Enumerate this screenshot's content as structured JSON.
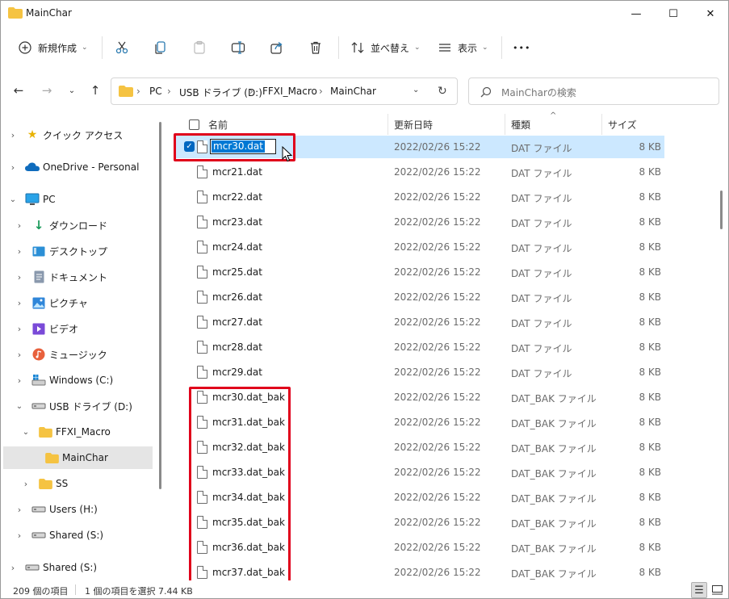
{
  "window": {
    "title": "MainChar",
    "minimize": "—",
    "maximize": "☐",
    "close": "✕"
  },
  "toolbar": {
    "new_label": "新規作成",
    "cut_icon": "scissors-icon",
    "copy_icon": "copy-icon",
    "paste_icon": "paste-icon",
    "rename_icon": "rename-icon",
    "share_icon": "share-icon",
    "delete_icon": "trash-icon",
    "sort_label": "並べ替え",
    "view_label": "表示",
    "more_label": "•••"
  },
  "address": {
    "crumbs": [
      "PC",
      "USB ドライブ (D:)",
      "FFXI_Macro",
      "MainChar"
    ],
    "search_placeholder": "MainCharの検索"
  },
  "nav": {
    "items": [
      {
        "label": "クイック アクセス"
      },
      {
        "label": "OneDrive - Personal"
      },
      {
        "label": "PC"
      },
      {
        "label": "ダウンロード"
      },
      {
        "label": "デスクトップ"
      },
      {
        "label": "ドキュメント"
      },
      {
        "label": "ピクチャ"
      },
      {
        "label": "ビデオ"
      },
      {
        "label": "ミュージック"
      },
      {
        "label": "Windows (C:)"
      },
      {
        "label": "USB ドライブ (D:)"
      },
      {
        "label": "FFXI_Macro"
      },
      {
        "label": "MainChar"
      },
      {
        "label": "SS"
      },
      {
        "label": "Users (H:)"
      },
      {
        "label": "Shared (S:)"
      },
      {
        "label": "Shared (S:)"
      }
    ]
  },
  "columns": {
    "name": "名前",
    "date": "更新日時",
    "type": "種類",
    "size": "サイズ"
  },
  "files": [
    {
      "name": "mcr30.dat",
      "date": "2022/02/26 15:22",
      "type": "DAT ファイル",
      "size": "8 KB"
    },
    {
      "name": "mcr21.dat",
      "date": "2022/02/26 15:22",
      "type": "DAT ファイル",
      "size": "8 KB"
    },
    {
      "name": "mcr22.dat",
      "date": "2022/02/26 15:22",
      "type": "DAT ファイル",
      "size": "8 KB"
    },
    {
      "name": "mcr23.dat",
      "date": "2022/02/26 15:22",
      "type": "DAT ファイル",
      "size": "8 KB"
    },
    {
      "name": "mcr24.dat",
      "date": "2022/02/26 15:22",
      "type": "DAT ファイル",
      "size": "8 KB"
    },
    {
      "name": "mcr25.dat",
      "date": "2022/02/26 15:22",
      "type": "DAT ファイル",
      "size": "8 KB"
    },
    {
      "name": "mcr26.dat",
      "date": "2022/02/26 15:22",
      "type": "DAT ファイル",
      "size": "8 KB"
    },
    {
      "name": "mcr27.dat",
      "date": "2022/02/26 15:22",
      "type": "DAT ファイル",
      "size": "8 KB"
    },
    {
      "name": "mcr28.dat",
      "date": "2022/02/26 15:22",
      "type": "DAT ファイル",
      "size": "8 KB"
    },
    {
      "name": "mcr29.dat",
      "date": "2022/02/26 15:22",
      "type": "DAT ファイル",
      "size": "8 KB"
    },
    {
      "name": "mcr30.dat_bak",
      "date": "2022/02/26 15:22",
      "type": "DAT_BAK ファイル",
      "size": "8 KB"
    },
    {
      "name": "mcr31.dat_bak",
      "date": "2022/02/26 15:22",
      "type": "DAT_BAK ファイル",
      "size": "8 KB"
    },
    {
      "name": "mcr32.dat_bak",
      "date": "2022/02/26 15:22",
      "type": "DAT_BAK ファイル",
      "size": "8 KB"
    },
    {
      "name": "mcr33.dat_bak",
      "date": "2022/02/26 15:22",
      "type": "DAT_BAK ファイル",
      "size": "8 KB"
    },
    {
      "name": "mcr34.dat_bak",
      "date": "2022/02/26 15:22",
      "type": "DAT_BAK ファイル",
      "size": "8 KB"
    },
    {
      "name": "mcr35.dat_bak",
      "date": "2022/02/26 15:22",
      "type": "DAT_BAK ファイル",
      "size": "8 KB"
    },
    {
      "name": "mcr36.dat_bak",
      "date": "2022/02/26 15:22",
      "type": "DAT_BAK ファイル",
      "size": "8 KB"
    },
    {
      "name": "mcr37.dat_bak",
      "date": "2022/02/26 15:22",
      "type": "DAT_BAK ファイル",
      "size": "8 KB"
    }
  ],
  "status": {
    "count": "209 個の項目",
    "selection": "1 個の項目を選択  7.44 KB"
  },
  "colors": {
    "accent": "#0067c0",
    "selection": "#cce8ff",
    "highlight_box": "#e0001b",
    "folder": "#f5c342"
  }
}
